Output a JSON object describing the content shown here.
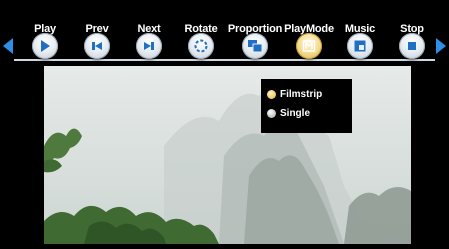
{
  "toolbar": {
    "buttons": [
      {
        "label": "Play",
        "icon": "play-icon"
      },
      {
        "label": "Prev",
        "icon": "prev-icon"
      },
      {
        "label": "Next",
        "icon": "next-icon"
      },
      {
        "label": "Rotate",
        "icon": "rotate-icon"
      },
      {
        "label": "Proportion",
        "icon": "proportion-icon"
      },
      {
        "label": "PlayMode",
        "icon": "playmode-icon",
        "active": true
      },
      {
        "label": "Music",
        "icon": "music-icon"
      },
      {
        "label": "Stop",
        "icon": "stop-icon"
      }
    ],
    "nav_left_icon": "arrow-left-icon",
    "nav_right_icon": "arrow-right-icon"
  },
  "playmode_menu": {
    "options": [
      {
        "label": "Filmstrip",
        "selected": true
      },
      {
        "label": "Single",
        "selected": false
      }
    ]
  },
  "colors": {
    "accent": "#2f8fe6",
    "icon_blue": "#1f6fc4",
    "active_gold": "#f4d98a"
  }
}
